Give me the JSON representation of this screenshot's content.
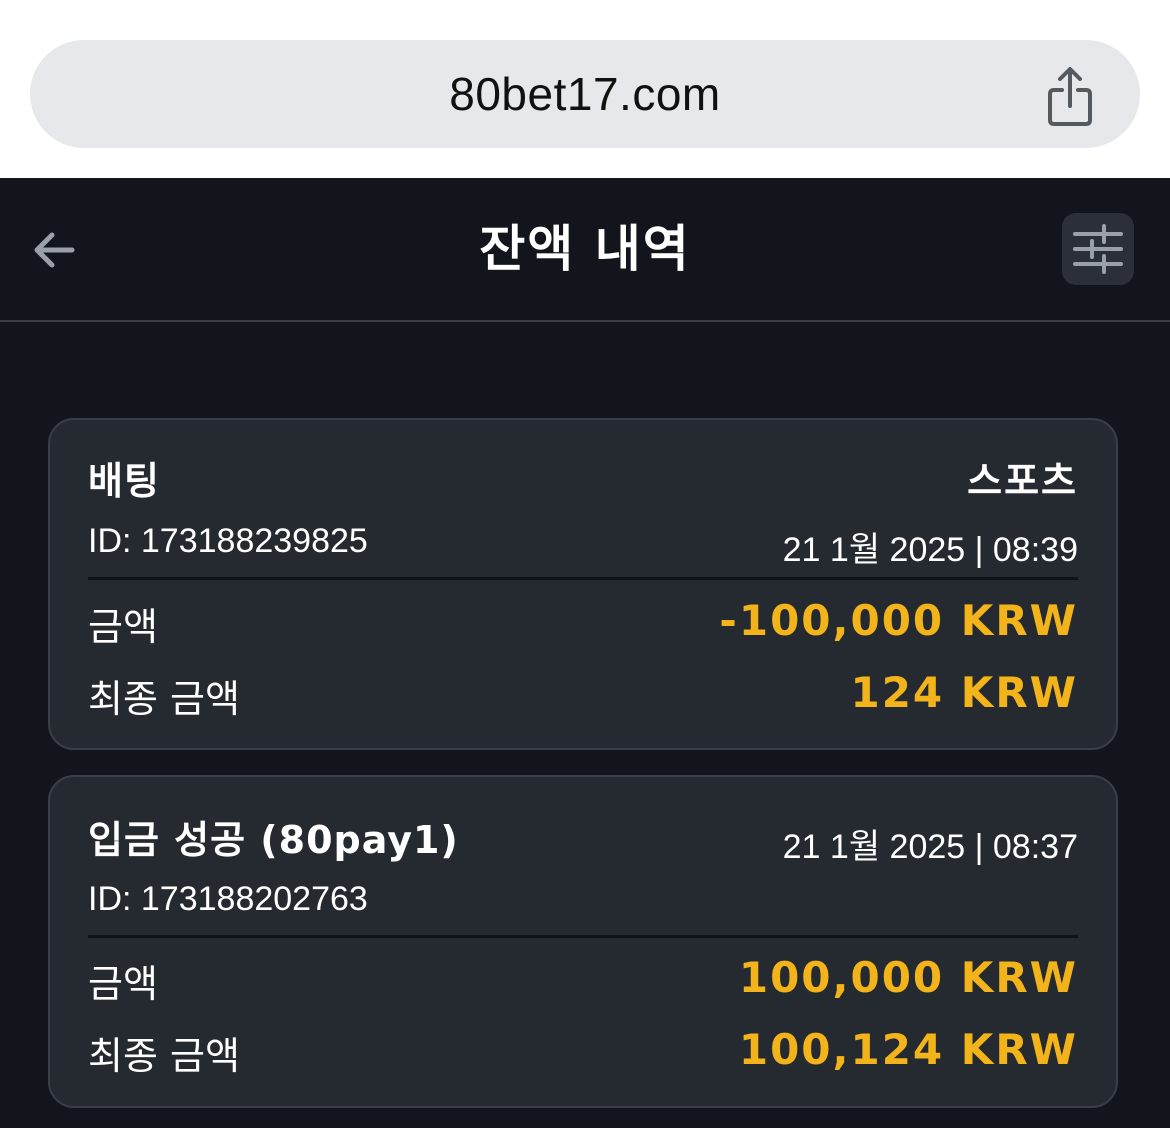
{
  "browser": {
    "url": "80bet17.com",
    "share_icon": "share-icon"
  },
  "header": {
    "title": "잔액 내역",
    "back_icon": "arrow-left-icon",
    "filter_icon": "sliders-icon"
  },
  "transactions": [
    {
      "type": "배팅",
      "category": "스포츠",
      "id": "ID: 173188239825",
      "datetime": "21 1월 2025 | 08:39",
      "amount_label": "금액",
      "amount": "-100,000 KRW",
      "final_label": "최종 금액",
      "final_amount": "124 KRW"
    },
    {
      "type": "입금 성공 (80pay1)",
      "datetime": "21 1월 2025 | 08:37",
      "id": "ID: 173188202763",
      "amount_label": "금액",
      "amount": "100,000 KRW",
      "final_label": "최종 금액",
      "final_amount": "100,124 KRW"
    }
  ],
  "colors": {
    "accent": "#f3b41b",
    "background": "#12161c",
    "card": "#252a31"
  }
}
